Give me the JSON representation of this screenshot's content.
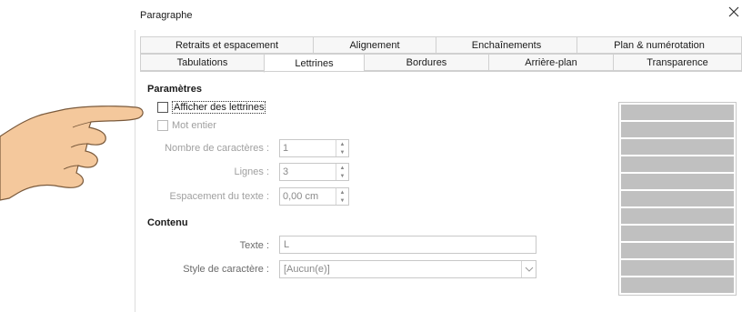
{
  "dialog": {
    "title": "Paragraphe"
  },
  "tabs_row1": [
    {
      "label": "Retraits et espacement",
      "width": 190
    },
    {
      "label": "Alignement",
      "width": 135
    },
    {
      "label": "Enchaînements",
      "width": 155
    },
    {
      "label": "Plan & numérotation",
      "width": 182
    }
  ],
  "tabs_row2": [
    {
      "label": "Tabulations",
      "width": 136
    },
    {
      "label": "Lettrines",
      "width": 110,
      "active": true
    },
    {
      "label": "Bordures",
      "width": 137
    },
    {
      "label": "Arrière-plan",
      "width": 137
    },
    {
      "label": "Transparence",
      "width": 142
    }
  ],
  "parametres": {
    "heading": "Paramètres",
    "show_dropcaps": "Afficher des lettrines",
    "whole_word": "Mot entier",
    "num_chars_label": "Nombre de caractères :",
    "num_chars_value": "1",
    "lines_label": "Lignes :",
    "lines_value": "3",
    "spacing_label": "Espacement du texte :",
    "spacing_value": "0,00 cm"
  },
  "contenu": {
    "heading": "Contenu",
    "text_label": "Texte :",
    "text_value": "L",
    "style_label": "Style de caractère :",
    "style_value": "[Aucun(e)]"
  },
  "preview_bars": 11,
  "colors": {
    "preview_bar": "#c0c0c0",
    "hand_skin": "#f4c89c",
    "hand_outline": "#7a5a3c"
  }
}
